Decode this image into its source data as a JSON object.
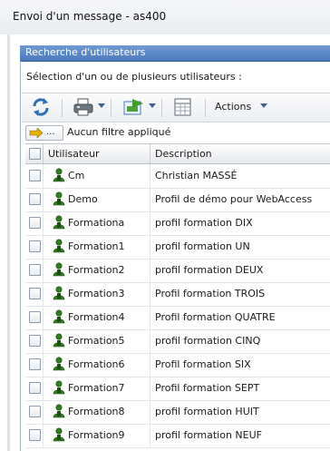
{
  "window": {
    "title": "Envoi d'un message - as400"
  },
  "panel": {
    "title": "Recherche d'utilisateurs",
    "subtitle": "Sélection d'un ou de plusieurs utilisateurs :"
  },
  "toolbar": {
    "refresh_icon": "refresh-icon",
    "print_icon": "printer-icon",
    "export_icon": "export-icon",
    "columns_icon": "table-columns-icon",
    "actions_label": "Actions"
  },
  "filter": {
    "button_glyph": "...",
    "label": "Aucun filtre appliqué"
  },
  "table": {
    "columns": [
      "Utilisateur",
      "Description"
    ],
    "rows": [
      {
        "user": "Cm",
        "description": "Christian MASSÉ"
      },
      {
        "user": "Demo",
        "description": "Profil de démo pour WebAccess"
      },
      {
        "user": "Formationa",
        "description": "profil formation DIX"
      },
      {
        "user": "Formation1",
        "description": "profil formation UN"
      },
      {
        "user": "Formation2",
        "description": "profil formation DEUX"
      },
      {
        "user": "Formation3",
        "description": "Profil formation TROIS"
      },
      {
        "user": "Formation4",
        "description": "Profil formation QUATRE"
      },
      {
        "user": "Formation5",
        "description": "profil formation CINQ"
      },
      {
        "user": "Formation6",
        "description": "Profil formation SIX"
      },
      {
        "user": "Formation7",
        "description": "Profil formation SEPT"
      },
      {
        "user": "Formation8",
        "description": "profil formation HUIT"
      },
      {
        "user": "Formation9",
        "description": "profil formation NEUF"
      }
    ]
  },
  "colors": {
    "panel_header": "#4b79bd",
    "user_icon": "#2e7d1e"
  }
}
